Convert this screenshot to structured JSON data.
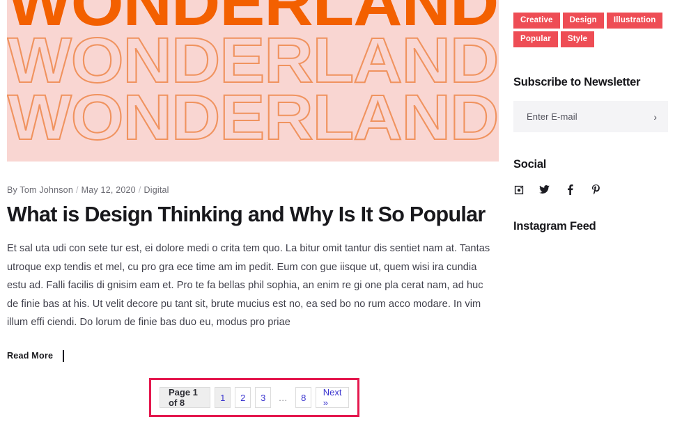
{
  "hero": {
    "alt": "wonderland-poster-image",
    "lines": [
      "WONDERLAND",
      "WONDERLAND",
      "WONDERLAND"
    ],
    "bg_color": "#f9d6d2",
    "solid_color": "#f36000",
    "outline_color": "#f0935f"
  },
  "post": {
    "meta": {
      "author": "By Tom Johnson",
      "date": "May 12, 2020",
      "category": "Digital",
      "separator": "/"
    },
    "title": "What is Design Thinking and Why Is It So Popular",
    "body": "Et sal uta udi con sete tur est, ei dolore medi o crita tem quo. La bitur omit tantur dis sentiet nam at. Tantas utroque exp tendis et mel, cu pro gra ece time am im pedit. Eum con gue iisque ut, quem wisi ira cundia estu ad. Falli facilis di gnisim eam et. Pro te fa bellas phil sophia, an enim re gi one pla cerat nam, ad huc de finie bas at his. Ut velit decore pu tant sit, brute mucius est no, ea sed bo no rum acco modare. In vim illum effi ciendi. Do lorum de finie bas duo eu, modus pro priae",
    "read_more": "Read More"
  },
  "pagination": {
    "info": "Page 1 of 8",
    "items": [
      {
        "label": "1",
        "state": "current"
      },
      {
        "label": "2",
        "state": "link"
      },
      {
        "label": "3",
        "state": "link"
      },
      {
        "label": "…",
        "state": "dots"
      },
      {
        "label": "8",
        "state": "link"
      }
    ],
    "next": "Next »",
    "highlight_color": "#e4184e",
    "link_color": "#3b35cf"
  },
  "sidebar": {
    "tags": [
      {
        "label": "Creative"
      },
      {
        "label": "Design"
      },
      {
        "label": "Illustration"
      },
      {
        "label": "Popular"
      },
      {
        "label": "Style"
      }
    ],
    "tag_color": "#ee4d55",
    "newsletter": {
      "heading": "Subscribe to Newsletter",
      "placeholder": "Enter E-mail",
      "value": "",
      "submit_label": "›"
    },
    "social": {
      "heading": "Social",
      "items": [
        {
          "name": "instagram"
        },
        {
          "name": "twitter"
        },
        {
          "name": "facebook"
        },
        {
          "name": "pinterest"
        }
      ]
    },
    "instagram_feed": {
      "heading": "Instagram Feed"
    }
  }
}
